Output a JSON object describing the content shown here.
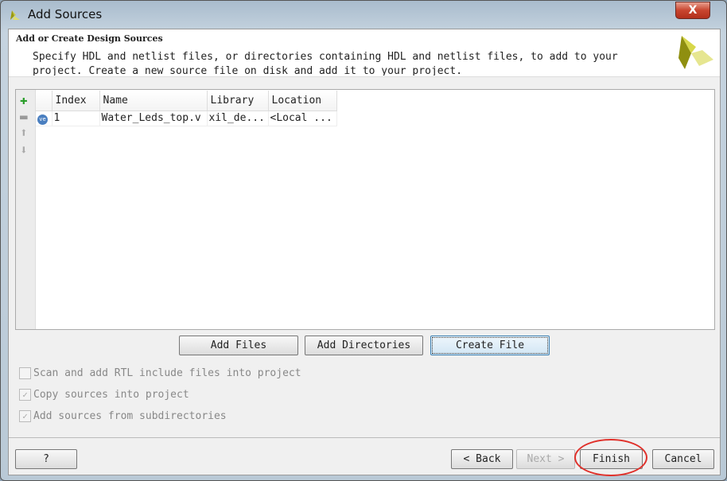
{
  "window": {
    "title": "Add Sources",
    "close_label": "X"
  },
  "header": {
    "title": "Add or Create Design Sources",
    "description": "Specify HDL and netlist files, or directories containing HDL and netlist files, to add to your project. Create a new source file on disk and add it to your project."
  },
  "table": {
    "columns": [
      "Index",
      "Name",
      "Library",
      "Location"
    ],
    "rows": [
      {
        "icon": "verilog-file-icon",
        "badge": "ve",
        "index": "1",
        "name": "Water_Leds_top.v",
        "library": "xil_de...",
        "location": "<Local ..."
      }
    ]
  },
  "side_tools": [
    "add-icon",
    "remove-icon",
    "move-up-icon",
    "move-down-icon"
  ],
  "actions": {
    "add_files": "Add Files",
    "add_directories": "Add Directories",
    "create_file": "Create File"
  },
  "options": [
    {
      "label": "Scan and add RTL include files into project",
      "checked": false
    },
    {
      "label": "Copy sources into project",
      "checked": true
    },
    {
      "label": "Add sources from subdirectories",
      "checked": true
    }
  ],
  "footer": {
    "help": "?",
    "back": "< Back",
    "next": "Next >",
    "finish": "Finish",
    "cancel": "Cancel"
  },
  "colors": {
    "highlight_ring": "#e0302a",
    "add_green": "#2a9d2a"
  }
}
